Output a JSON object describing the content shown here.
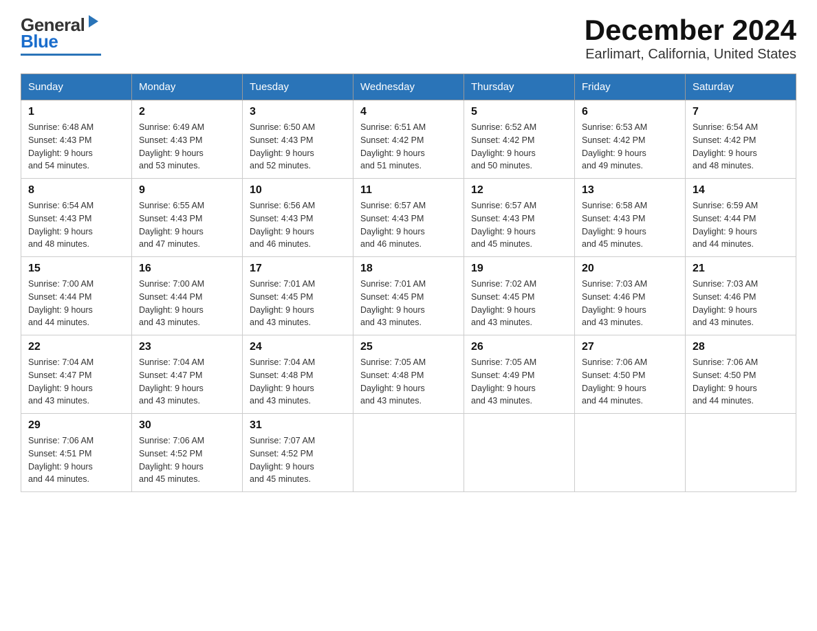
{
  "header": {
    "logo_general": "General",
    "logo_blue": "Blue",
    "title": "December 2024",
    "subtitle": "Earlimart, California, United States"
  },
  "calendar": {
    "days_of_week": [
      "Sunday",
      "Monday",
      "Tuesday",
      "Wednesday",
      "Thursday",
      "Friday",
      "Saturday"
    ],
    "weeks": [
      [
        {
          "day": "1",
          "sunrise": "6:48 AM",
          "sunset": "4:43 PM",
          "daylight": "9 hours and 54 minutes."
        },
        {
          "day": "2",
          "sunrise": "6:49 AM",
          "sunset": "4:43 PM",
          "daylight": "9 hours and 53 minutes."
        },
        {
          "day": "3",
          "sunrise": "6:50 AM",
          "sunset": "4:43 PM",
          "daylight": "9 hours and 52 minutes."
        },
        {
          "day": "4",
          "sunrise": "6:51 AM",
          "sunset": "4:42 PM",
          "daylight": "9 hours and 51 minutes."
        },
        {
          "day": "5",
          "sunrise": "6:52 AM",
          "sunset": "4:42 PM",
          "daylight": "9 hours and 50 minutes."
        },
        {
          "day": "6",
          "sunrise": "6:53 AM",
          "sunset": "4:42 PM",
          "daylight": "9 hours and 49 minutes."
        },
        {
          "day": "7",
          "sunrise": "6:54 AM",
          "sunset": "4:42 PM",
          "daylight": "9 hours and 48 minutes."
        }
      ],
      [
        {
          "day": "8",
          "sunrise": "6:54 AM",
          "sunset": "4:43 PM",
          "daylight": "9 hours and 48 minutes."
        },
        {
          "day": "9",
          "sunrise": "6:55 AM",
          "sunset": "4:43 PM",
          "daylight": "9 hours and 47 minutes."
        },
        {
          "day": "10",
          "sunrise": "6:56 AM",
          "sunset": "4:43 PM",
          "daylight": "9 hours and 46 minutes."
        },
        {
          "day": "11",
          "sunrise": "6:57 AM",
          "sunset": "4:43 PM",
          "daylight": "9 hours and 46 minutes."
        },
        {
          "day": "12",
          "sunrise": "6:57 AM",
          "sunset": "4:43 PM",
          "daylight": "9 hours and 45 minutes."
        },
        {
          "day": "13",
          "sunrise": "6:58 AM",
          "sunset": "4:43 PM",
          "daylight": "9 hours and 45 minutes."
        },
        {
          "day": "14",
          "sunrise": "6:59 AM",
          "sunset": "4:44 PM",
          "daylight": "9 hours and 44 minutes."
        }
      ],
      [
        {
          "day": "15",
          "sunrise": "7:00 AM",
          "sunset": "4:44 PM",
          "daylight": "9 hours and 44 minutes."
        },
        {
          "day": "16",
          "sunrise": "7:00 AM",
          "sunset": "4:44 PM",
          "daylight": "9 hours and 43 minutes."
        },
        {
          "day": "17",
          "sunrise": "7:01 AM",
          "sunset": "4:45 PM",
          "daylight": "9 hours and 43 minutes."
        },
        {
          "day": "18",
          "sunrise": "7:01 AM",
          "sunset": "4:45 PM",
          "daylight": "9 hours and 43 minutes."
        },
        {
          "day": "19",
          "sunrise": "7:02 AM",
          "sunset": "4:45 PM",
          "daylight": "9 hours and 43 minutes."
        },
        {
          "day": "20",
          "sunrise": "7:03 AM",
          "sunset": "4:46 PM",
          "daylight": "9 hours and 43 minutes."
        },
        {
          "day": "21",
          "sunrise": "7:03 AM",
          "sunset": "4:46 PM",
          "daylight": "9 hours and 43 minutes."
        }
      ],
      [
        {
          "day": "22",
          "sunrise": "7:04 AM",
          "sunset": "4:47 PM",
          "daylight": "9 hours and 43 minutes."
        },
        {
          "day": "23",
          "sunrise": "7:04 AM",
          "sunset": "4:47 PM",
          "daylight": "9 hours and 43 minutes."
        },
        {
          "day": "24",
          "sunrise": "7:04 AM",
          "sunset": "4:48 PM",
          "daylight": "9 hours and 43 minutes."
        },
        {
          "day": "25",
          "sunrise": "7:05 AM",
          "sunset": "4:48 PM",
          "daylight": "9 hours and 43 minutes."
        },
        {
          "day": "26",
          "sunrise": "7:05 AM",
          "sunset": "4:49 PM",
          "daylight": "9 hours and 43 minutes."
        },
        {
          "day": "27",
          "sunrise": "7:06 AM",
          "sunset": "4:50 PM",
          "daylight": "9 hours and 44 minutes."
        },
        {
          "day": "28",
          "sunrise": "7:06 AM",
          "sunset": "4:50 PM",
          "daylight": "9 hours and 44 minutes."
        }
      ],
      [
        {
          "day": "29",
          "sunrise": "7:06 AM",
          "sunset": "4:51 PM",
          "daylight": "9 hours and 44 minutes."
        },
        {
          "day": "30",
          "sunrise": "7:06 AM",
          "sunset": "4:52 PM",
          "daylight": "9 hours and 45 minutes."
        },
        {
          "day": "31",
          "sunrise": "7:07 AM",
          "sunset": "4:52 PM",
          "daylight": "9 hours and 45 minutes."
        },
        null,
        null,
        null,
        null
      ]
    ]
  }
}
